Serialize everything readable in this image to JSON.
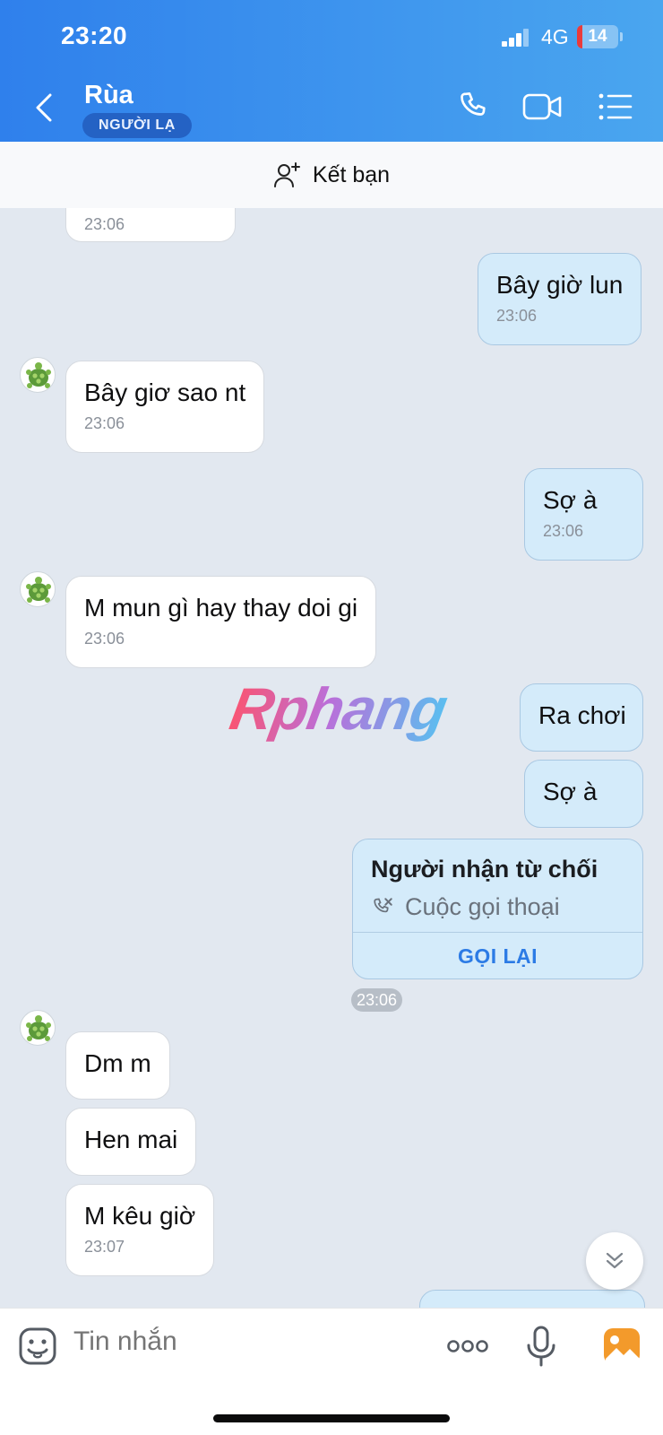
{
  "status_bar": {
    "time": "23:20",
    "network": "4G",
    "battery_level": "14",
    "battery_fraction": 0.14,
    "battery_color": "#ea3b3b"
  },
  "header": {
    "contact_name": "Rùa",
    "badge": "NGƯỜI LẠ",
    "icons": [
      "back-arrow-icon",
      "phone-icon",
      "video-call-icon",
      "menu-list-icon"
    ]
  },
  "friend_bar": {
    "label": "Kết bạn",
    "icon": "add-friend-icon"
  },
  "messages": [
    {
      "direction": "in",
      "text": "",
      "time": "23:06"
    },
    {
      "direction": "out",
      "text": "Bây giờ lun",
      "time": "23:06"
    },
    {
      "direction": "in",
      "text": "Bây giơ sao nt",
      "time": "23:06"
    },
    {
      "direction": "out",
      "text": "Sợ à",
      "time": "23:06"
    },
    {
      "direction": "in",
      "text": "M mun gì hay thay doi gi",
      "time": "23:06"
    },
    {
      "direction": "out",
      "text": "Ra chơi",
      "time": ""
    },
    {
      "direction": "out",
      "text": "Sợ à",
      "time": ""
    },
    {
      "direction": "in",
      "text": "Dm m",
      "time": ""
    },
    {
      "direction": "in",
      "text": "Hen mai",
      "time": ""
    },
    {
      "direction": "in",
      "text": "M kêu giờ",
      "time": "23:07"
    }
  ],
  "call_card": {
    "title": "Người nhận từ chối",
    "subtitle": "Cuộc gọi thoại",
    "action": "GỌI LẠI",
    "time": "23:06",
    "icon": "missed-call-icon"
  },
  "watermark": "Rphang",
  "composer": {
    "placeholder": "Tin nhắn",
    "icons": [
      "sticker-icon",
      "more-options-icon",
      "microphone-icon",
      "image-gallery-icon"
    ]
  },
  "colors": {
    "header_start": "#2f80ec",
    "header_end": "#4aa6ef",
    "outgoing_bubble": "#d4ebfa",
    "incoming_bubble": "#ffffff",
    "chat_background": "#e2e8f0",
    "accent": "#2c7be5"
  }
}
